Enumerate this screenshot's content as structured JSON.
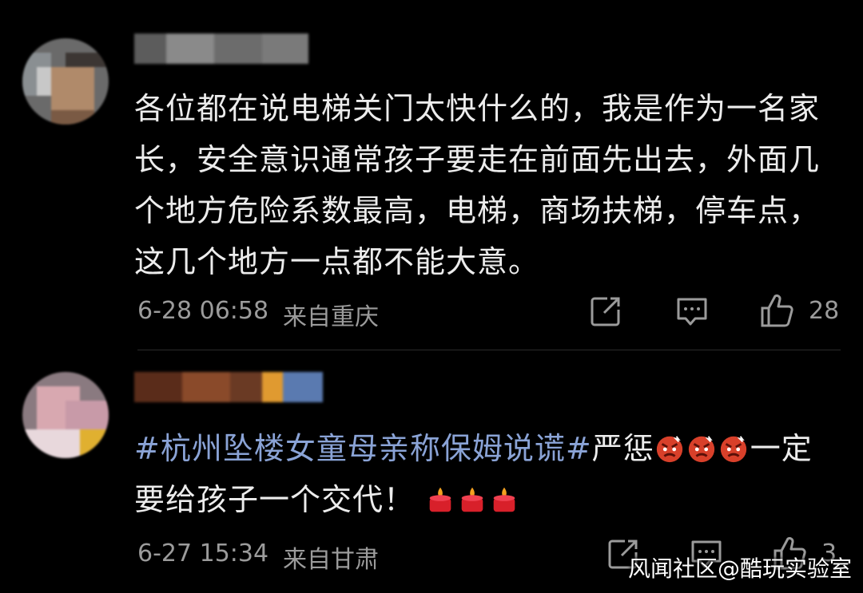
{
  "comments": [
    {
      "text": "各位都在说电梯关门太快什么的，我是作为一名家长，安全意识通常孩子要走在前面先出去，外面几个地方危险系数最高，电梯，商场扶梯，停车点，这几个地方一点都不能大意。",
      "time": "6-28 06:58",
      "location": "来自重庆",
      "likes": "28"
    },
    {
      "hashtag": "#杭州坠楼女童母亲称保姆说谎#",
      "text_a": "严惩",
      "text_b": "一定要给孩子一个交代！",
      "time": "6-27 15:34",
      "location": "来自甘肃",
      "likes": "3"
    }
  ],
  "icons": {
    "share": "share-icon",
    "comment": "comment-icon",
    "like": "thumbs-up-icon",
    "angry_emoji": "angry-face-icon",
    "candle_emoji": "candle-icon"
  },
  "watermark": "风闻社区@酷玩实验室",
  "colors": {
    "background": "#000000",
    "hashtag": "#8aa3d6",
    "meta": "#9b9b9b"
  }
}
